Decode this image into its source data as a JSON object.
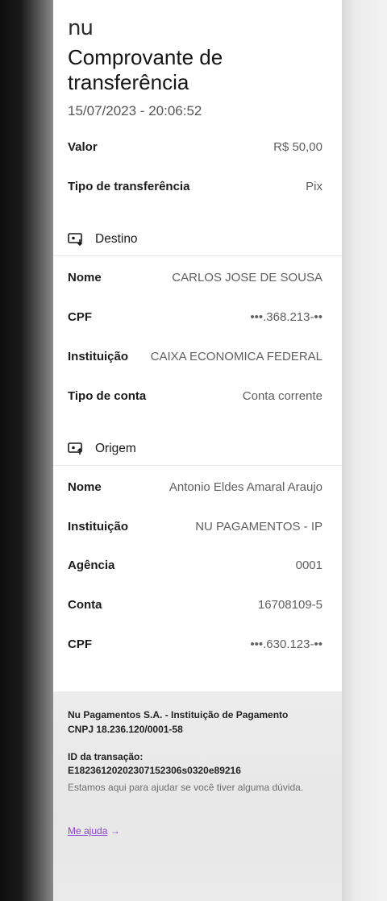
{
  "brand": {
    "logo": "nu"
  },
  "header": {
    "title": "Comprovante de transferência",
    "datetime": "15/07/2023 - 20:06:52"
  },
  "summary": [
    {
      "key": "Valor",
      "value": "R$ 50,00"
    },
    {
      "key": "Tipo de transferência",
      "value": "Pix"
    }
  ],
  "destino": {
    "heading": "Destino",
    "icon": "transfer-in-icon",
    "rows": [
      {
        "key": "Nome",
        "value": "CARLOS JOSE DE SOUSA"
      },
      {
        "key": "CPF",
        "value": "•••.368.213-••"
      },
      {
        "key": "Instituição",
        "value": "CAIXA ECONOMICA FEDERAL"
      },
      {
        "key": "Tipo de conta",
        "value": "Conta corrente"
      }
    ]
  },
  "origem": {
    "heading": "Origem",
    "icon": "transfer-out-icon",
    "rows": [
      {
        "key": "Nome",
        "value": "Antonio Eldes Amaral Araujo"
      },
      {
        "key": "Instituição",
        "value": "NU PAGAMENTOS - IP"
      },
      {
        "key": "Agência",
        "value": "0001"
      },
      {
        "key": "Conta",
        "value": "16708109-5"
      },
      {
        "key": "CPF",
        "value": "•••.630.123-••"
      }
    ]
  },
  "footer": {
    "company": "Nu Pagamentos S.A. - Instituição de Pagamento",
    "cnpj": "CNPJ 18.236.120/0001-58",
    "transaction_label": "ID da transação:",
    "transaction_id": "E18236120202307152306s0320e89216",
    "help_text": "Estamos aqui para ajudar se você tiver alguma dúvida.",
    "help_link": "Me ajuda",
    "help_link_arrow": "→"
  },
  "colors": {
    "accent": "#8a3fd6",
    "text": "#1b1b1b",
    "muted": "#606060"
  }
}
